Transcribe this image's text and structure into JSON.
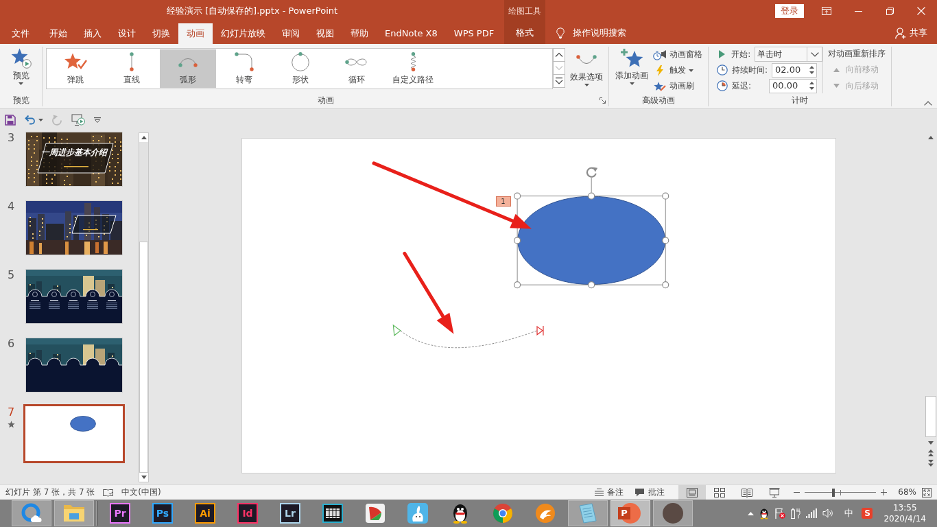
{
  "window": {
    "title": "经验演示 [自动保存的].pptx - PowerPoint",
    "tool_header": "绘图工具",
    "sign_in": "登录"
  },
  "ribbon_tabs": [
    {
      "label": "文件",
      "kind": "file",
      "selected": false
    },
    {
      "label": "开始",
      "kind": "tab",
      "selected": false
    },
    {
      "label": "插入",
      "kind": "tab",
      "selected": false
    },
    {
      "label": "设计",
      "kind": "tab",
      "selected": false
    },
    {
      "label": "切换",
      "kind": "tab",
      "selected": false
    },
    {
      "label": "动画",
      "kind": "tab",
      "selected": true
    },
    {
      "label": "幻灯片放映",
      "kind": "tab",
      "selected": false
    },
    {
      "label": "审阅",
      "kind": "tab",
      "selected": false
    },
    {
      "label": "视图",
      "kind": "tab",
      "selected": false
    },
    {
      "label": "帮助",
      "kind": "tab",
      "selected": false
    },
    {
      "label": "EndNote X8",
      "kind": "tab",
      "selected": false
    },
    {
      "label": "WPS PDF",
      "kind": "tab",
      "selected": false
    },
    {
      "label": "格式",
      "kind": "context",
      "selected": false
    }
  ],
  "tell_me": "操作说明搜索",
  "share": "共享",
  "ribbon": {
    "preview": {
      "button": "预览",
      "label": "预览"
    },
    "animation": {
      "label": "动画",
      "gallery": [
        {
          "label": "弹跳",
          "kind": "bounce",
          "selected": false
        },
        {
          "label": "直线",
          "kind": "line",
          "selected": false
        },
        {
          "label": "弧形",
          "kind": "arc",
          "selected": true
        },
        {
          "label": "转弯",
          "kind": "turn",
          "selected": false
        },
        {
          "label": "形状",
          "kind": "shape",
          "selected": false
        },
        {
          "label": "循环",
          "kind": "loop",
          "selected": false
        },
        {
          "label": "自定义路径",
          "kind": "custom",
          "selected": false
        }
      ],
      "scroll": [
        {
          "kind": "up",
          "disabled": false
        },
        {
          "kind": "down",
          "disabled": true
        },
        {
          "kind": "more",
          "disabled": false
        }
      ],
      "effect_options": "效果选项"
    },
    "advanced": {
      "label": "高级动画",
      "add_animation": "添加动画",
      "buttons": [
        {
          "label": "动画窗格",
          "kind": "pane",
          "dropdown": false
        },
        {
          "label": "触发",
          "kind": "trigger",
          "dropdown": true
        },
        {
          "label": "动画刷",
          "kind": "painter",
          "dropdown": false
        }
      ]
    },
    "timing": {
      "label": "计时",
      "start": {
        "label": "开始:",
        "value": "单击时"
      },
      "duration": {
        "label": "持续时间:",
        "value": "02.00"
      },
      "delay": {
        "label": "延迟:",
        "value": "00.00"
      },
      "reorder_title": "对动画重新排序",
      "reorder": [
        {
          "label": "向前移动",
          "kind": "earlier",
          "disabled": true
        },
        {
          "label": "向后移动",
          "kind": "later",
          "disabled": true
        }
      ]
    }
  },
  "quick_access": [
    {
      "kind": "save",
      "disabled": false
    },
    {
      "kind": "undo",
      "disabled": false
    },
    {
      "kind": "undo-menu",
      "disabled": false
    },
    {
      "kind": "redo",
      "disabled": true
    },
    {
      "kind": "from-start",
      "disabled": false
    },
    {
      "kind": "customize",
      "disabled": false
    }
  ],
  "slides_panel": [
    {
      "number": "3",
      "kind": "title-photo",
      "title": "一周进步基本介绍",
      "selected": false,
      "animated": false
    },
    {
      "number": "4",
      "kind": "city-photo",
      "selected": false,
      "animated": false
    },
    {
      "number": "5",
      "kind": "arches-cards",
      "selected": false,
      "animated": false
    },
    {
      "number": "6",
      "kind": "arches",
      "selected": false,
      "animated": false
    },
    {
      "number": "7",
      "kind": "ellipse",
      "selected": true,
      "animated": true
    }
  ],
  "slide": {
    "animation_tag": "1"
  },
  "status_bar": {
    "slide_info": "幻灯片 第 7 张，共 7 张",
    "language": "中文(中国)",
    "notes": "备注",
    "comments": "批注",
    "views": [
      {
        "kind": "normal",
        "selected": true
      },
      {
        "kind": "sorter",
        "selected": false
      },
      {
        "kind": "reading",
        "selected": false
      },
      {
        "kind": "slideshow",
        "selected": false
      }
    ],
    "zoom": {
      "level": 0.4,
      "reading": "68%"
    }
  },
  "taskbar": {
    "apps": [
      {
        "kind": "ring-browser",
        "open": true,
        "selected": false
      },
      {
        "kind": "folder",
        "open": true,
        "selected": false
      },
      {
        "kind": "letter-tile",
        "letters": "Pr",
        "color": "#ea77ff",
        "open": false,
        "selected": false
      },
      {
        "kind": "letter-tile",
        "letters": "Ps",
        "color": "#31a8ff",
        "open": false,
        "selected": false
      },
      {
        "kind": "letter-tile",
        "letters": "Ai",
        "color": "#ff9a00",
        "open": false,
        "selected": false
      },
      {
        "kind": "letter-tile",
        "letters": "Id",
        "color": "#ff3366",
        "open": false,
        "selected": false
      },
      {
        "kind": "letter-tile",
        "letters": "Lr",
        "color": "#add5ec",
        "open": false,
        "selected": false
      },
      {
        "kind": "film",
        "open": false,
        "selected": false
      },
      {
        "kind": "fan",
        "open": false,
        "selected": false
      },
      {
        "kind": "rabbit",
        "open": false,
        "selected": false
      },
      {
        "kind": "penguin",
        "open": false,
        "selected": false
      },
      {
        "kind": "tricolor",
        "open": false,
        "selected": false
      },
      {
        "kind": "cheetah",
        "open": false,
        "selected": false
      },
      {
        "kind": "notepad",
        "open": true,
        "selected": false
      },
      {
        "kind": "presentation",
        "letters": "P",
        "open": true,
        "selected": true
      },
      {
        "kind": "photo",
        "open": true,
        "selected": false
      }
    ],
    "tray": {
      "ime": "中",
      "input_method_letter": "S",
      "time": "13:55",
      "date": "2020/4/14"
    }
  }
}
